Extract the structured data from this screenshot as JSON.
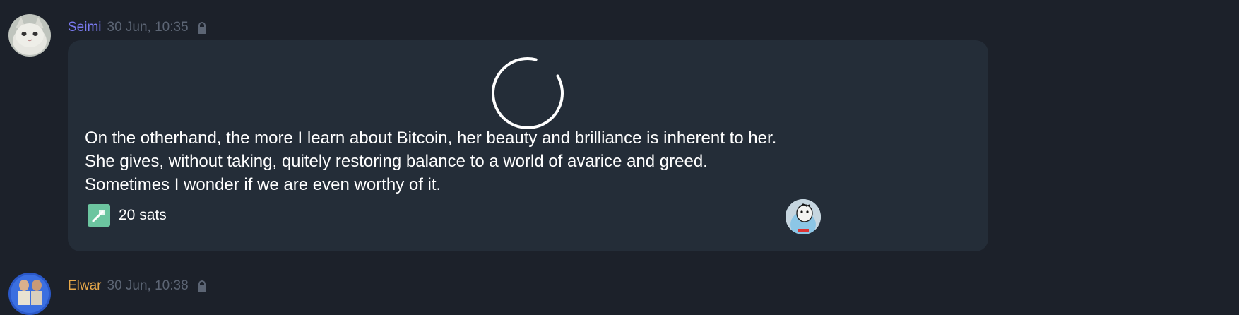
{
  "messages": [
    {
      "author": "Seimi",
      "time": "30 Jun, 10:35",
      "author_color": "#7a7af0",
      "text_lines": [
        "On the otherhand, the more I learn about Bitcoin, her beauty and brilliance is inherent to her.",
        "She gives, without taking, quitely restoring balance to a world of avarice and greed.",
        "Sometimes I wonder if we are even worthy of it."
      ],
      "zap_label": "20 sats",
      "icons": {
        "avatar": "cat-avatar",
        "lock": "lock-icon",
        "loading": "loading-spinner",
        "zap": "zap-icon",
        "reactor": "reactor-avatar"
      }
    },
    {
      "author": "Elwar",
      "time": "30 Jun, 10:38",
      "author_color": "#e8a94a",
      "icons": {
        "avatar": "elwar-avatar",
        "lock": "lock-icon"
      }
    }
  ],
  "colors": {
    "background": "#1c212a",
    "bubble": "#242d38",
    "timestamp": "#5c6574",
    "zap_badge": "#6cc5a0"
  }
}
